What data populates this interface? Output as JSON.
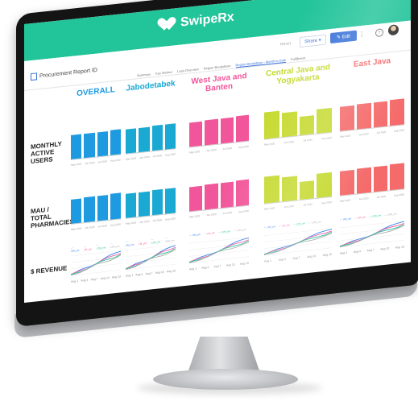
{
  "app": {
    "brand": "SwipeRx",
    "brand_color": "#22c49a",
    "report_title": "Procurement Report ID",
    "reset_label": "Reset",
    "share_label": "Share",
    "edit_label": "Edit",
    "more_icon": "kebab-menu-icon",
    "help_icon": "help-icon"
  },
  "tabs": [
    {
      "label": "Summary"
    },
    {
      "label": "Key Metrics"
    },
    {
      "label": "Loan Overview"
    },
    {
      "label": "Region Breakdown"
    },
    {
      "label": "Region Breakdown - Month to Date",
      "active": true
    },
    {
      "label": "Fulfillment"
    }
  ],
  "row_labels": [
    "MONTHLY ACTIVE USERS",
    "MAU / TOTAL PHARMACIES",
    "$ REVENUE"
  ],
  "columns": [
    {
      "title": "OVERALL",
      "color": "#1e9be0"
    },
    {
      "title": "Jabodetabek",
      "color": "#19a9d3"
    },
    {
      "title": "West Java and Banten",
      "color": "#f2569a"
    },
    {
      "title": "Central Java and Yogyakarta",
      "color": "#c5d92d"
    },
    {
      "title": "East Java",
      "color": "#f56a6a"
    }
  ],
  "bar_values": {
    "mau": [
      [
        0.78,
        0.8,
        0.8,
        0.82
      ],
      [
        0.78,
        0.8,
        0.82,
        0.82
      ],
      [
        0.8,
        0.82,
        0.82,
        0.84
      ],
      [
        0.88,
        0.78,
        0.6,
        0.78
      ],
      [
        0.8,
        0.82,
        0.82,
        0.84
      ]
    ],
    "ratio": [
      [
        0.8,
        0.82,
        0.82,
        0.84
      ],
      [
        0.78,
        0.8,
        0.82,
        0.82
      ],
      [
        0.8,
        0.82,
        0.82,
        0.84
      ],
      [
        0.88,
        0.78,
        0.58,
        0.78
      ],
      [
        0.8,
        0.82,
        0.82,
        0.84
      ]
    ]
  },
  "bar_ticks": [
    "May 2020",
    "Jun 2020",
    "Jul 2020",
    "Aug 2020"
  ],
  "line_legend": [
    "UM_ym",
    "LM_ym",
    "L2M_ym",
    "L3M_ym"
  ],
  "line_colors": [
    "#2e7df0",
    "#f2569a",
    "#22c49a",
    "#aaaaaa"
  ],
  "line_ticks": [
    "Aug 1",
    "Aug 4",
    "Aug 7",
    "Aug 10",
    "Aug 13"
  ]
}
